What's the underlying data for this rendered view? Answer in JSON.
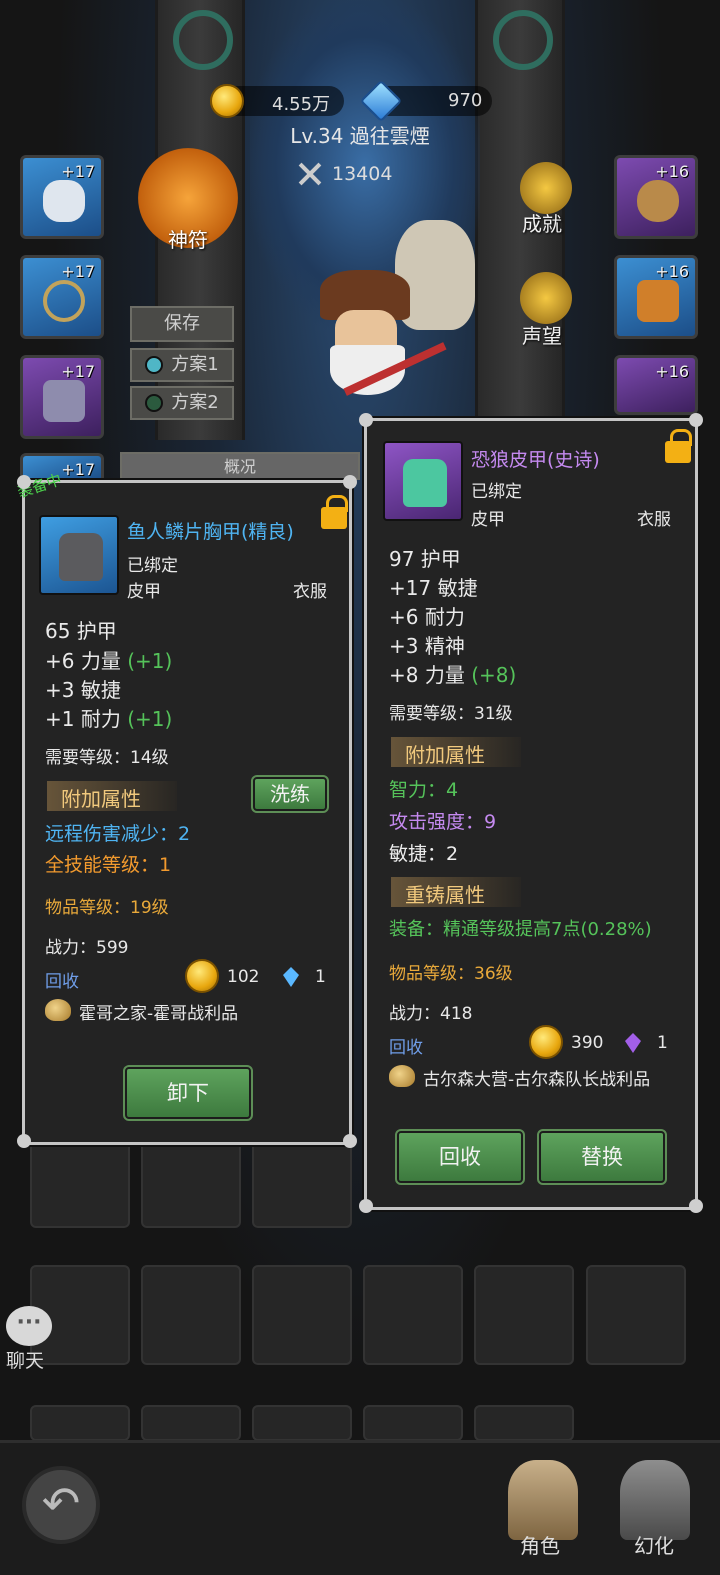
{
  "header": {
    "gold": "4.55万",
    "diamonds": "970",
    "level_name": "Lv.34 過往雲煙",
    "combat_power": "13404"
  },
  "left_slots": [
    {
      "plus": "+17",
      "icon": "helmet-icon",
      "rarity": "blue"
    },
    {
      "plus": "+17",
      "icon": "necklace-icon",
      "rarity": "blue"
    },
    {
      "plus": "+17",
      "icon": "shoulder-icon",
      "rarity": "purple"
    },
    {
      "plus": "+17",
      "icon": "chest-icon",
      "rarity": "blue"
    }
  ],
  "right_slots": [
    {
      "plus": "+16",
      "icon": "cannon-icon",
      "rarity": "purple"
    },
    {
      "plus": "+16",
      "icon": "cloak-icon",
      "rarity": "blue"
    },
    {
      "plus": "+16",
      "icon": "boots-icon",
      "rarity": "purple"
    }
  ],
  "scene": {
    "shenfu": "神符",
    "achievement": "成就",
    "reputation": "声望",
    "save": "保存",
    "plan1": "方案1",
    "plan2": "方案2",
    "overview_tab": "概况"
  },
  "equipped_card": {
    "badge": "装备中",
    "name": "鱼人鳞片胸甲(精良)",
    "bound": "已绑定",
    "type": "皮甲",
    "slot": "衣服",
    "armor": "65 护甲",
    "stats": [
      {
        "base": "+6 力量",
        "bonus": "(+1)"
      },
      {
        "base": "+3 敏捷",
        "bonus": ""
      },
      {
        "base": "+1 耐力",
        "bonus": "(+1)"
      }
    ],
    "req_level": "需要等级：14级",
    "extra_title": "附加属性",
    "refine_button": "洗练",
    "extra1": "远程伤害减少：2",
    "extra2": "全技能等级：1",
    "item_level": "物品等级：19级",
    "power": "战力：599",
    "recycle": "回收",
    "coins": "102",
    "gems": "1",
    "source": "霍哥之家-霍哥战利品",
    "unequip_button": "卸下"
  },
  "new_card": {
    "name": "恐狼皮甲(史诗)",
    "bound": "已绑定",
    "type": "皮甲",
    "slot": "衣服",
    "armor": "97 护甲",
    "stats": [
      {
        "base": "+17 敏捷",
        "bonus": ""
      },
      {
        "base": "+6 耐力",
        "bonus": ""
      },
      {
        "base": "+3 精神",
        "bonus": ""
      },
      {
        "base": "+8 力量",
        "bonus": "(+8)"
      }
    ],
    "req_level": "需要等级：31级",
    "extra_title": "附加属性",
    "extra1": "智力：4",
    "extra2": "攻击强度：9",
    "extra3": "敏捷：2",
    "reforge_title": "重铸属性",
    "reforge": "装备：精通等级提高7点(0.28%)",
    "item_level": "物品等级：36级",
    "power": "战力：418",
    "recycle": "回收",
    "coins": "390",
    "gems": "1",
    "source": "古尔森大营-古尔森队长战利品",
    "recycle_button": "回收",
    "replace_button": "替换"
  },
  "chat_label": "聊天",
  "nav": {
    "character": "角色",
    "transform": "幻化"
  },
  "colors": {
    "blue_name": "#4fb4f2",
    "purple_name": "#c58af0",
    "green_bonus": "#55c35a",
    "gold_text": "#e9a93a",
    "orange_text": "#f29a2e"
  }
}
